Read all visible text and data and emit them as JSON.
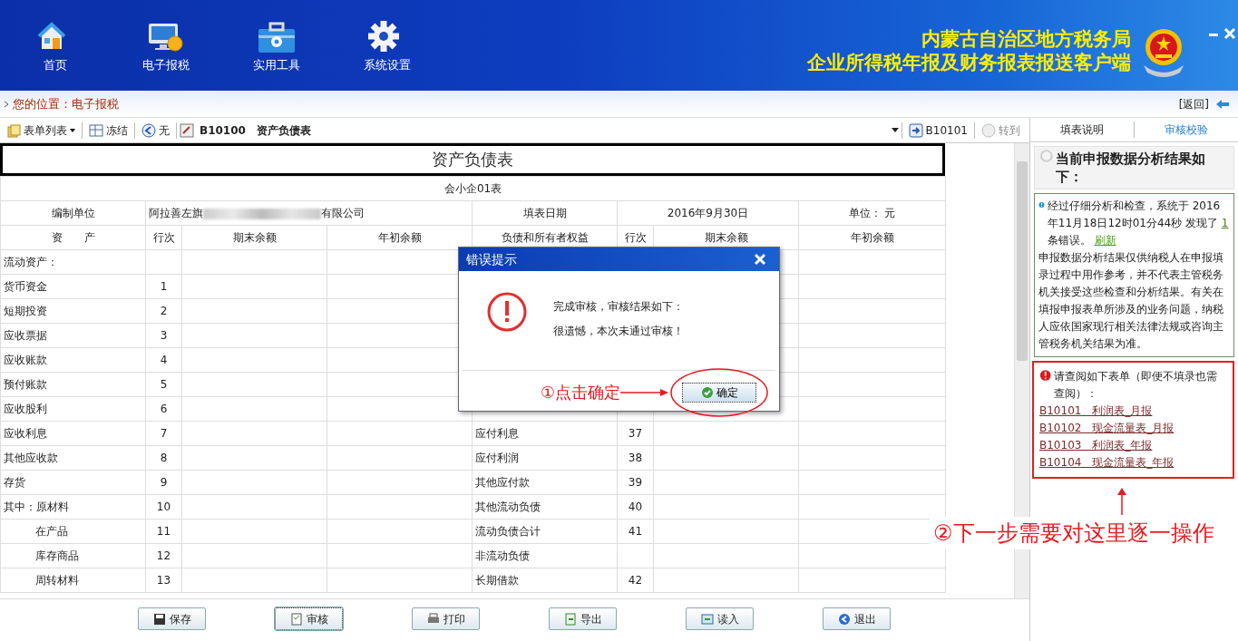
{
  "header": {
    "nav": [
      {
        "label": "首页",
        "kind": "home"
      },
      {
        "label": "电子报税",
        "kind": "tax"
      },
      {
        "label": "实用工具",
        "kind": "tools"
      },
      {
        "label": "系统设置",
        "kind": "settings"
      }
    ],
    "title_lines": [
      "内蒙古自治区地方税务局",
      "企业所得税年报及财务报表报送客户端"
    ]
  },
  "location": {
    "label": "您的位置：电子报税",
    "back": "[返回]"
  },
  "toolbar": {
    "items": [
      {
        "label": "表单列表",
        "kind": "list"
      },
      {
        "label": "冻结",
        "kind": "freeze"
      },
      {
        "label": "无",
        "kind": "prev"
      }
    ],
    "form_code": "B10100",
    "form_name": "资产负债表",
    "next": "B10101",
    "goto": "转到"
  },
  "form": {
    "title": "资产负债表",
    "subtitle": "会小企01表",
    "info": {
      "unit_label": "编制单位",
      "company_parts": [
        "阿拉善左旗",
        "有限公司"
      ],
      "date_label": "填表日期",
      "date": "2016年9月30日",
      "currency": "单位： 元"
    },
    "columns": [
      "资　　产",
      "行次",
      "期末余额",
      "年初余额",
      "负债和所有者权益",
      "行次",
      "期末余额",
      "年初余额"
    ],
    "rows": [
      {
        "asset": "流动资产：",
        "no": "",
        "liability": "",
        "lno": "",
        "indented": false
      },
      {
        "asset": "货币资金",
        "no": "1",
        "liability": "",
        "lno": "",
        "indented": false
      },
      {
        "asset": "短期投资",
        "no": "2",
        "liability": "",
        "lno": "",
        "indented": false
      },
      {
        "asset": "应收票据",
        "no": "3",
        "liability": "",
        "lno": "",
        "indented": false
      },
      {
        "asset": "应收账款",
        "no": "4",
        "liability": "",
        "lno": "",
        "indented": false
      },
      {
        "asset": "预付账款",
        "no": "5",
        "liability": "",
        "lno": "",
        "indented": false
      },
      {
        "asset": "应收股利",
        "no": "6",
        "liability": "",
        "lno": "",
        "indented": false
      },
      {
        "asset": "应收利息",
        "no": "7",
        "liability": "应付利息",
        "lno": "37",
        "indented": false
      },
      {
        "asset": "其他应收款",
        "no": "8",
        "liability": "应付利润",
        "lno": "38",
        "indented": false
      },
      {
        "asset": "存货",
        "no": "9",
        "liability": "其他应付款",
        "lno": "39",
        "indented": false
      },
      {
        "asset": "其中：原材料",
        "no": "10",
        "liability": "其他流动负债",
        "lno": "40",
        "indented": false
      },
      {
        "asset": "在产品",
        "no": "11",
        "liability": "流动负债合计",
        "lno": "41",
        "indented": true
      },
      {
        "asset": "库存商品",
        "no": "12",
        "liability": "非流动负债",
        "lno": "",
        "indented": true
      },
      {
        "asset": "周转材料",
        "no": "13",
        "liability": "长期借款",
        "lno": "42",
        "indented": true
      }
    ]
  },
  "buttons": [
    {
      "label": "保存",
      "kind": "save",
      "selected": false
    },
    {
      "label": "审核",
      "kind": "audit",
      "selected": true
    },
    {
      "label": "打印",
      "kind": "print",
      "selected": false
    },
    {
      "label": "导出",
      "kind": "export",
      "selected": false
    },
    {
      "label": "读入",
      "kind": "import",
      "selected": false
    },
    {
      "label": "退出",
      "kind": "exit",
      "selected": false
    }
  ],
  "dialog": {
    "title": "错误提示",
    "lines": [
      "完成审核，审核结果如下：",
      "很遗憾，本次未通过审核！"
    ],
    "ok": "确定"
  },
  "side": {
    "tabs": [
      {
        "label": "填表说明",
        "selected": false
      },
      {
        "label": "审核校验",
        "selected": true
      }
    ],
    "heading": "当前申报数据分析结果如下：",
    "summary": {
      "before": "经过仔细分析和检查，系统于 2016年11月18日12时01分44秒 发现了",
      "count": "1",
      "after": "条错误。",
      "refresh": "刷新"
    },
    "note": "申报数据分析结果仅供纳税人在申报填录过程中用作参考，并不代表主管税务机关接受这些检查和分析结果。有关在填报申报表单所涉及的业务问题，纳税人应依国家现行相关法律法规或咨询主管税务机关结果为准。",
    "review_heading": "请查阅如下表单（即便不填录也需查阅）：",
    "links": [
      "B10101　利润表_月报",
      "B10102　现金流量表_月报",
      "B10103　利润表_年报",
      "B10104　现金流量表_年报"
    ]
  },
  "annotations": {
    "step1": "①点击确定",
    "step2": "②下一步需要对这里逐一操作"
  }
}
